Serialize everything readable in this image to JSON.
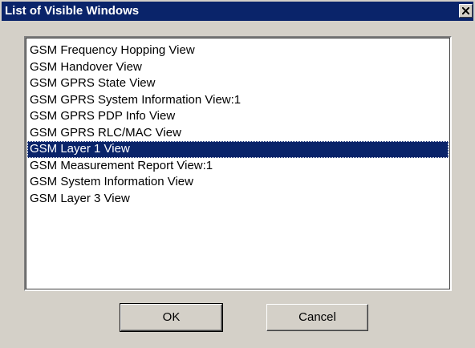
{
  "window": {
    "title": "List of Visible Windows",
    "title_bar_color": "#0a246a",
    "face_color": "#d4d0c8"
  },
  "titlebar_controls": {
    "close_icon": "close-icon"
  },
  "list": {
    "selected_index": 6,
    "items": [
      {
        "label": "GSM Frequency Hopping View"
      },
      {
        "label": "GSM Handover View"
      },
      {
        "label": "GSM GPRS State View"
      },
      {
        "label": "GSM GPRS System Information View:1"
      },
      {
        "label": "GSM GPRS PDP Info View"
      },
      {
        "label": "GSM GPRS RLC/MAC View"
      },
      {
        "label": "GSM Layer 1 View"
      },
      {
        "label": "GSM Measurement Report View:1"
      },
      {
        "label": "GSM System Information View"
      },
      {
        "label": "GSM Layer 3 View"
      }
    ]
  },
  "buttons": {
    "ok_label": "OK",
    "cancel_label": "Cancel"
  }
}
